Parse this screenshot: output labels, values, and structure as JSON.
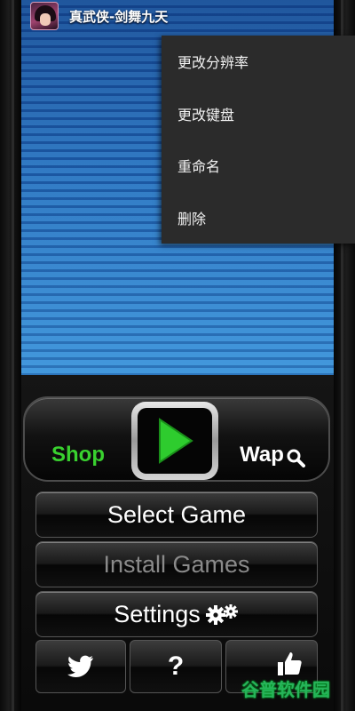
{
  "app": {
    "title": "真武侠-剑舞九天"
  },
  "context_menu": {
    "items": [
      {
        "label": "更改分辨率"
      },
      {
        "label": "更改键盘"
      },
      {
        "label": "重命名"
      },
      {
        "label": "删除"
      }
    ]
  },
  "console": {
    "shop_label": "Shop",
    "wap_label": "Wap",
    "play_icon": "play-icon",
    "wap_icon": "magnifier-icon"
  },
  "buttons": {
    "select_game": "Select Game",
    "install_games": "Install Games",
    "settings": "Settings"
  },
  "bottom_bar": {
    "twitter_icon": "twitter-bird-icon",
    "help_label": "?",
    "like_icon": "thumbs-up-icon"
  },
  "watermark": "谷普软件园",
  "colors": {
    "shop_green": "#39d12f",
    "play_green": "#2ecc2e",
    "menu_bg": "#2b2b2b",
    "screen_blue": "#3b8fd6"
  }
}
